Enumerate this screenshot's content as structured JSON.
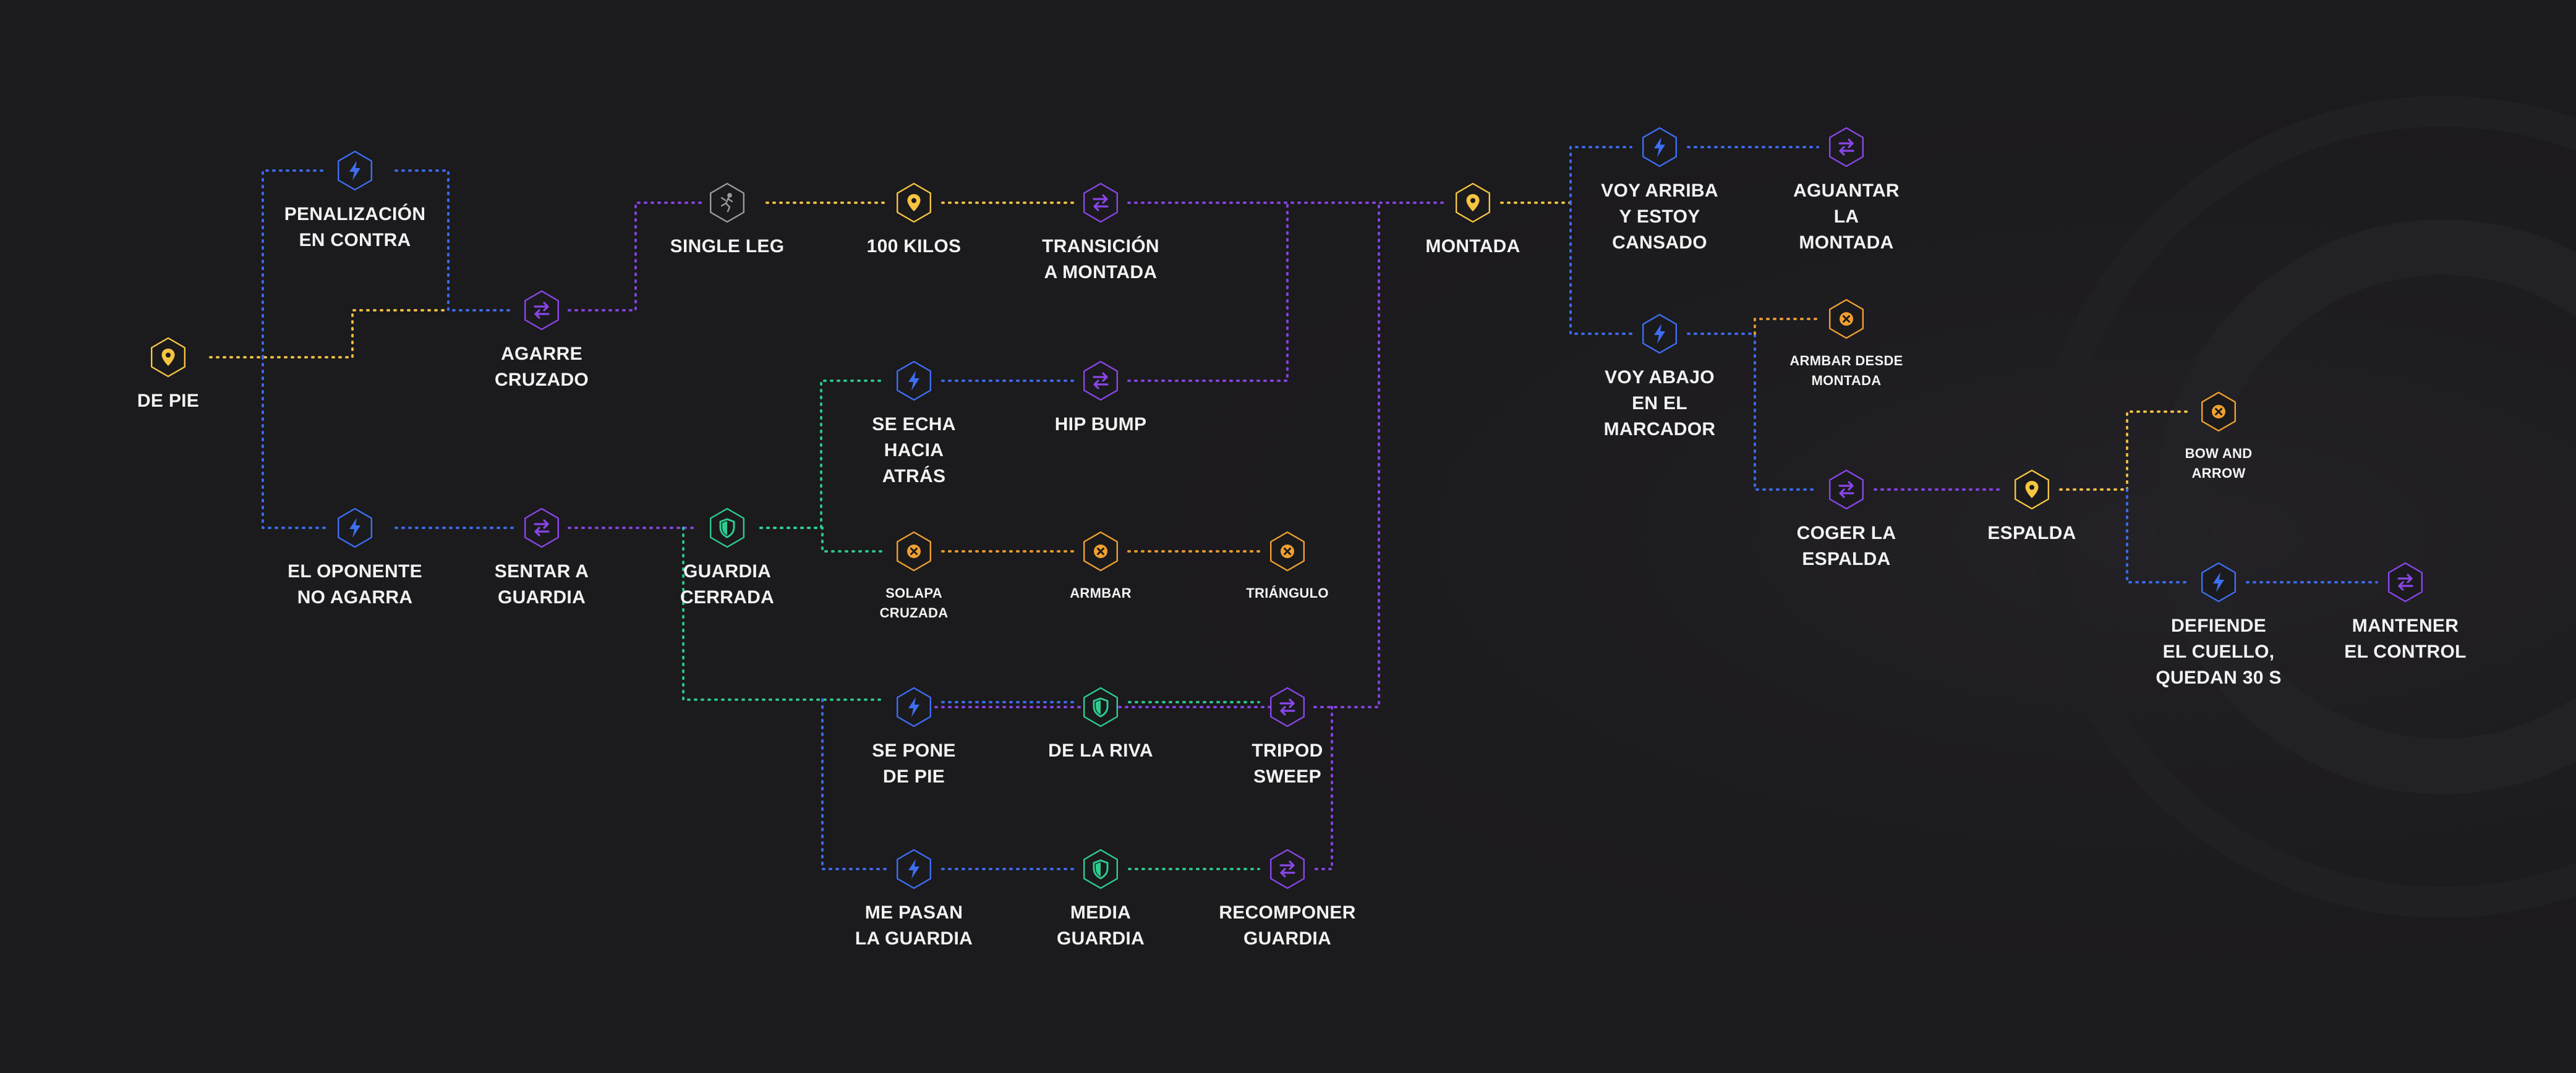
{
  "colors": {
    "background": "#1b1a1d",
    "position": "#f5c542",
    "event": "#3d6ff2",
    "transition": "#8a46e8",
    "guard": "#2ecc8f",
    "submission": "#f0a030",
    "takedown": "#9a9aa0"
  },
  "nodes": [
    {
      "id": "de-pie",
      "label": "DE PIE",
      "kind": "position",
      "icon": "map-pin-icon",
      "small": false
    },
    {
      "id": "penalizacion",
      "label": "PENALIZACIÓN\nEN CONTRA",
      "kind": "event",
      "icon": "lightning-icon",
      "small": false
    },
    {
      "id": "agarre-cruzado",
      "label": "AGARRE\nCRUZADO",
      "kind": "transition",
      "icon": "swap-arrows-icon",
      "small": false
    },
    {
      "id": "el-oponente",
      "label": "EL OPONENTE\nNO AGARRA",
      "kind": "event",
      "icon": "lightning-icon",
      "small": false
    },
    {
      "id": "sentar-guardia",
      "label": "SENTAR A\nGUARDIA",
      "kind": "transition",
      "icon": "swap-arrows-icon",
      "small": false
    },
    {
      "id": "guardia-cerrada",
      "label": "GUARDIA\nCERRADA",
      "kind": "guard",
      "icon": "shield-icon",
      "small": false
    },
    {
      "id": "single-leg",
      "label": "SINGLE LEG",
      "kind": "takedown",
      "icon": "wrestler-icon",
      "small": false
    },
    {
      "id": "cien-kilos",
      "label": "100 KILOS",
      "kind": "position",
      "icon": "map-pin-icon",
      "small": false
    },
    {
      "id": "transicion-montada",
      "label": "TRANSICIÓN\nA MONTADA",
      "kind": "transition",
      "icon": "swap-arrows-icon",
      "small": false
    },
    {
      "id": "se-echa",
      "label": "SE ECHA\nHACIA\nATRÁS",
      "kind": "event",
      "icon": "lightning-icon",
      "small": false
    },
    {
      "id": "hip-bump",
      "label": "HIP BUMP",
      "kind": "transition",
      "icon": "swap-arrows-icon",
      "small": false
    },
    {
      "id": "solapa",
      "label": "SOLAPA\nCRUZADA",
      "kind": "submission",
      "icon": "x-circle-icon",
      "small": true
    },
    {
      "id": "armbar",
      "label": "ARMBAR",
      "kind": "submission",
      "icon": "x-circle-icon",
      "small": true
    },
    {
      "id": "triangulo",
      "label": "TRIÁNGULO",
      "kind": "submission",
      "icon": "x-circle-icon",
      "small": true
    },
    {
      "id": "se-pone-de-pie",
      "label": "SE PONE\nDE PIE",
      "kind": "event",
      "icon": "lightning-icon",
      "small": false
    },
    {
      "id": "de-la-riva",
      "label": "DE LA RIVA",
      "kind": "guard",
      "icon": "shield-icon",
      "small": false
    },
    {
      "id": "tripod-sweep",
      "label": "TRIPOD\nSWEEP",
      "kind": "transition",
      "icon": "swap-arrows-icon",
      "small": false
    },
    {
      "id": "me-pasan",
      "label": "ME PASAN\nLA GUARDIA",
      "kind": "event",
      "icon": "lightning-icon",
      "small": false
    },
    {
      "id": "media-guardia",
      "label": "MEDIA\nGUARDIA",
      "kind": "guard",
      "icon": "shield-icon",
      "small": false
    },
    {
      "id": "recomponer",
      "label": "RECOMPONER\nGUARDIA",
      "kind": "transition",
      "icon": "swap-arrows-icon",
      "small": false
    },
    {
      "id": "montada",
      "label": "MONTADA",
      "kind": "position",
      "icon": "map-pin-icon",
      "small": false
    },
    {
      "id": "voy-arriba",
      "label": "VOY ARRIBA\nY ESTOY\nCANSADO",
      "kind": "event",
      "icon": "lightning-icon",
      "small": false
    },
    {
      "id": "aguantar",
      "label": "AGUANTAR\nLA\nMONTADA",
      "kind": "transition",
      "icon": "swap-arrows-icon",
      "small": false
    },
    {
      "id": "voy-abajo",
      "label": "VOY ABAJO\nEN EL\nMARCADOR",
      "kind": "event",
      "icon": "lightning-icon",
      "small": false
    },
    {
      "id": "armbar-montada",
      "label": "ARMBAR DESDE\nMONTADA",
      "kind": "submission",
      "icon": "x-circle-icon",
      "small": true
    },
    {
      "id": "coger-espalda",
      "label": "COGER LA\nESPALDA",
      "kind": "transition",
      "icon": "swap-arrows-icon",
      "small": false
    },
    {
      "id": "espalda",
      "label": "ESPALDA",
      "kind": "position",
      "icon": "map-pin-icon",
      "small": false
    },
    {
      "id": "bow-arrow",
      "label": "BOW AND\nARROW",
      "kind": "submission",
      "icon": "x-circle-icon",
      "small": true
    },
    {
      "id": "defiende",
      "label": "DEFIENDE\nEL CUELLO,\nQUEDAN 30 S",
      "kind": "event",
      "icon": "lightning-icon",
      "small": false
    },
    {
      "id": "mantener",
      "label": "MANTENER\nEL CONTROL",
      "kind": "transition",
      "icon": "swap-arrows-icon",
      "small": false
    }
  ]
}
